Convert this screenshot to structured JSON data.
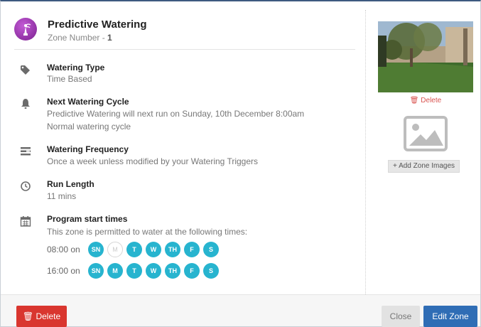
{
  "header": {
    "title": "Predictive Watering",
    "zone_number_label": "Zone Number - ",
    "zone_number": "1"
  },
  "watering_type": {
    "label": "Watering Type",
    "value": "Time Based",
    "icon": "tags-icon"
  },
  "next_cycle": {
    "label": "Next Watering Cycle",
    "line1": "Predictive Watering will next run on Sunday, 10th December 8:00am",
    "line2": "Normal watering cycle",
    "icon": "bell-icon"
  },
  "frequency": {
    "label": "Watering Frequency",
    "value": "Once a week unless modified by your Watering Triggers",
    "icon": "frequency-icon"
  },
  "run_length": {
    "label": "Run Length",
    "value": "11 mins",
    "icon": "clock-icon"
  },
  "program": {
    "label": "Program start times",
    "description": "This zone is permitted to water at the following times:",
    "icon": "calendar-icon",
    "times": [
      {
        "label": "08:00 on",
        "days": [
          {
            "d": "SN",
            "on": true
          },
          {
            "d": "M",
            "on": false
          },
          {
            "d": "T",
            "on": true
          },
          {
            "d": "W",
            "on": true
          },
          {
            "d": "TH",
            "on": true
          },
          {
            "d": "F",
            "on": true
          },
          {
            "d": "S",
            "on": true
          }
        ]
      },
      {
        "label": "16:00 on",
        "days": [
          {
            "d": "SN",
            "on": true
          },
          {
            "d": "M",
            "on": true
          },
          {
            "d": "T",
            "on": true
          },
          {
            "d": "W",
            "on": true
          },
          {
            "d": "TH",
            "on": true
          },
          {
            "d": "F",
            "on": true
          },
          {
            "d": "S",
            "on": true
          }
        ]
      }
    ]
  },
  "side": {
    "image_delete": "Delete",
    "add_images": "Add Zone Images"
  },
  "footer": {
    "delete": "Delete",
    "close": "Close",
    "edit": "Edit Zone"
  },
  "colors": {
    "day_on": "#27b4cf",
    "delete": "#d9362f",
    "edit": "#2f6db5",
    "avatar": "#9b34b0"
  }
}
